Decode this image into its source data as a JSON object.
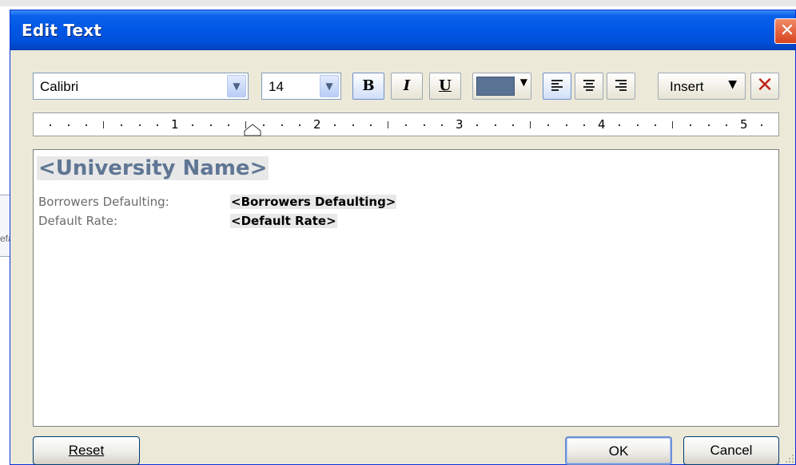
{
  "background": {
    "fragment_text": "efa"
  },
  "dialog": {
    "title": "Edit Text",
    "close_glyph": "✕"
  },
  "toolbar": {
    "font_family": "Calibri",
    "font_size": "14",
    "bold_label": "B",
    "italic_label": "I",
    "underline_label": "U",
    "text_color": "#5a7394",
    "insert_label": "Insert",
    "delete_glyph": "✕"
  },
  "ruler": {
    "numbers": [
      "1",
      "2",
      "3",
      "4",
      "5"
    ]
  },
  "editor": {
    "heading": "<University Name>",
    "rows": [
      {
        "label": "Borrowers Defaulting:",
        "value": "<Borrowers Defaulting>"
      },
      {
        "label": "Default Rate:",
        "value": "<Default Rate>"
      }
    ]
  },
  "buttons": {
    "reset": "Reset",
    "ok": "OK",
    "cancel": "Cancel"
  },
  "colors": {
    "accent": "#0058e6",
    "heading_text": "#5f7694"
  }
}
